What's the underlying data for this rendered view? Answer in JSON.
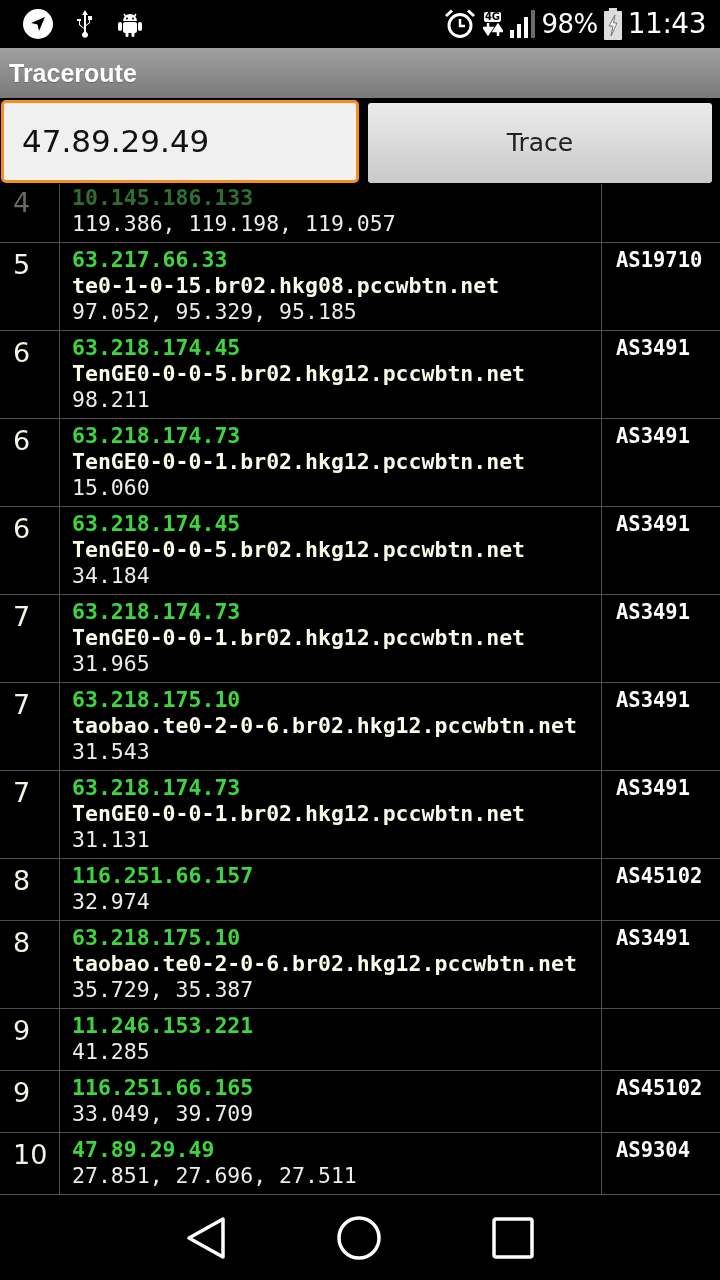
{
  "status_bar": {
    "network_type": "4G",
    "battery": "98%",
    "time": "11:43"
  },
  "app_bar": {
    "title": "Traceroute"
  },
  "trace_form": {
    "address": "47.89.29.49",
    "button": "Trace"
  },
  "hops": [
    {
      "hop": "4",
      "ip": "10.145.186.133",
      "times": "119.386, 119.198, 119.057",
      "faded": true
    },
    {
      "hop": "5",
      "ip": "63.217.66.33",
      "hostname": "te0-1-0-15.br02.hkg08.pccwbtn.net",
      "times": "97.052, 95.329, 95.185",
      "asn": "AS19710",
      "faded": false
    },
    {
      "hop": "6",
      "ip": "63.218.174.45",
      "hostname": "TenGE0-0-0-5.br02.hkg12.pccwbtn.net",
      "times": "98.211",
      "asn": "AS3491",
      "faded": false
    },
    {
      "hop": "6",
      "ip": "63.218.174.73",
      "hostname": "TenGE0-0-0-1.br02.hkg12.pccwbtn.net",
      "times": "15.060",
      "asn": "AS3491",
      "faded": false
    },
    {
      "hop": "6",
      "ip": "63.218.174.45",
      "hostname": "TenGE0-0-0-5.br02.hkg12.pccwbtn.net",
      "times": "34.184",
      "asn": "AS3491",
      "faded": false
    },
    {
      "hop": "7",
      "ip": "63.218.174.73",
      "hostname": "TenGE0-0-0-1.br02.hkg12.pccwbtn.net",
      "times": "31.965",
      "asn": "AS3491",
      "faded": false
    },
    {
      "hop": "7",
      "ip": "63.218.175.10",
      "hostname": "taobao.te0-2-0-6.br02.hkg12.pccwbtn.net",
      "times": "31.543",
      "asn": "AS3491",
      "faded": false
    },
    {
      "hop": "7",
      "ip": "63.218.174.73",
      "hostname": "TenGE0-0-0-1.br02.hkg12.pccwbtn.net",
      "times": "31.131",
      "asn": "AS3491",
      "faded": false
    },
    {
      "hop": "8",
      "ip": "116.251.66.157",
      "times": "32.974",
      "asn": "AS45102",
      "faded": false
    },
    {
      "hop": "8",
      "ip": "63.218.175.10",
      "hostname": "taobao.te0-2-0-6.br02.hkg12.pccwbtn.net",
      "times": "35.729, 35.387",
      "asn": "AS3491",
      "faded": false
    },
    {
      "hop": "9",
      "ip": "11.246.153.221",
      "times": "41.285",
      "faded": false
    },
    {
      "hop": "9",
      "ip": "116.251.66.165",
      "times": "33.049, 39.709",
      "asn": "AS45102",
      "faded": false
    },
    {
      "hop": "10",
      "ip": "47.89.29.49",
      "times": "27.851, 27.696, 27.511",
      "asn": "AS9304",
      "faded": false
    }
  ]
}
